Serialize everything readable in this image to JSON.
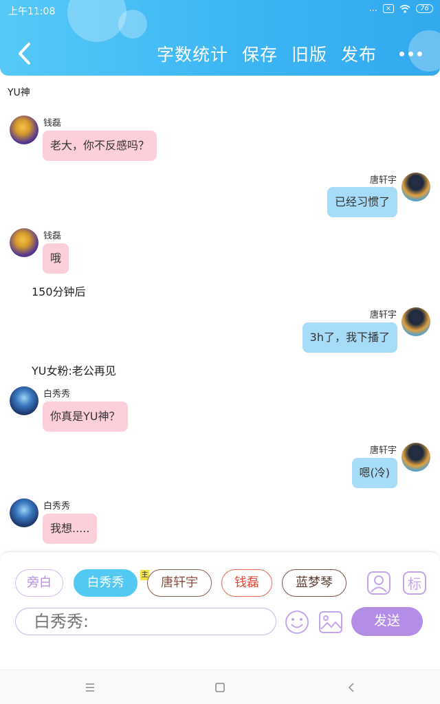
{
  "status_bar": {
    "time": "上午11:08",
    "signal": "...",
    "sim": "×",
    "battery": "76"
  },
  "header": {
    "actions": [
      "字数统计",
      "保存",
      "旧版",
      "发布"
    ],
    "accent": "#3cb5f4"
  },
  "chat": {
    "title": "YU神",
    "messages": [
      {
        "speaker": "钱磊",
        "text": "老大，你不反感吗？"
      },
      {
        "speaker": "唐轩宇",
        "text": "已经习惯了"
      },
      {
        "speaker": "钱磊",
        "text": "哦"
      },
      {
        "narration": "150分钟后"
      },
      {
        "speaker": "唐轩宇",
        "text": "3h了，我下播了"
      },
      {
        "narration": "YU女粉:老公再见"
      },
      {
        "speaker": "白秀秀",
        "text": "你真是YU神？"
      },
      {
        "speaker": "唐轩宇",
        "text": "嗯(冷)"
      },
      {
        "speaker": "白秀秀",
        "text": "我想....."
      }
    ]
  },
  "composer": {
    "characters": [
      "旁白",
      "白秀秀",
      "唐轩宇",
      "钱磊",
      "蓝梦琴"
    ],
    "main_tag": "主",
    "selected": "白秀秀",
    "marker_label": "标",
    "input_placeholder": "白秀秀:",
    "send_label": "发送",
    "colors": {
      "selected_chip": "#52c8f3",
      "send_button": "#b38de8",
      "left_bubble": "#fccfdb",
      "right_bubble": "#a7dcf8"
    }
  },
  "icons": {
    "back": "chevron-left-icon",
    "more": "more-dots-icon",
    "character": "character-card-icon",
    "emoji": "emoji-icon",
    "image": "image-icon",
    "nav_menu": "menu-icon",
    "nav_home": "home-square-icon",
    "nav_back": "back-icon"
  }
}
